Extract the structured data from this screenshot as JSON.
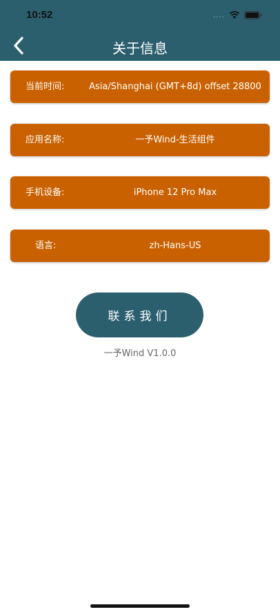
{
  "status_bar": {
    "time": "10:52",
    "dots": "....",
    "icons": [
      "wifi-icon",
      "battery-icon"
    ]
  },
  "nav": {
    "title": "关于信息",
    "back_icon": "chevron-left-icon",
    "background": "#2c5f6e"
  },
  "info_rows": [
    {
      "label": "当前时间:",
      "value": "Asia/Shanghai (GMT+8d) offset 28800"
    },
    {
      "label": "应用名称:",
      "value": "一予Wind-生活组件"
    },
    {
      "label": "手机设备:",
      "value": "iPhone 12 Pro Max"
    },
    {
      "label": "语言:",
      "value": "zh-Hans-US"
    }
  ],
  "row_color": "#c96100",
  "contact_button": {
    "label": "联系我们"
  },
  "version": "一予Wind V1.0.0"
}
